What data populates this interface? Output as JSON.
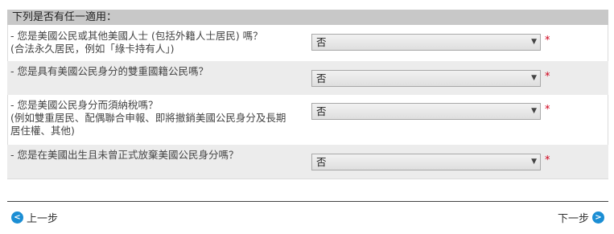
{
  "section": {
    "title": "下列是否有任一適用："
  },
  "questions": [
    {
      "lines": [
        "- 您是美國公民或其他美國人士 (包括外籍人士居民) 嗎？",
        "(合法永久居民，例如「綠卡持有人」)"
      ],
      "answer": "否"
    },
    {
      "lines": [
        "- 您是具有美國公民身分的雙重國籍公民嗎？"
      ],
      "answer": "否"
    },
    {
      "lines": [
        "- 您是美國公民身分而須納稅嗎？",
        "(例如雙重居民、配偶聯合申報、即將撤銷美國公民身分及長期",
        "居住權、其他)"
      ],
      "answer": "否"
    },
    {
      "lines": [
        "- 您是在美國出生且未曾正式放棄美國公民身分嗎？"
      ],
      "answer": "否"
    }
  ],
  "required_mark": "*",
  "nav": {
    "prev_label": "上一步",
    "next_label": "下一步",
    "prev_icon": "chevron-left-circle-icon",
    "next_icon": "chevron-right-circle-icon"
  },
  "colors": {
    "accent": "#1b8ed4",
    "required": "#d0021b",
    "header_bg": "#c8c8c8",
    "row_shade": "#ececec"
  }
}
